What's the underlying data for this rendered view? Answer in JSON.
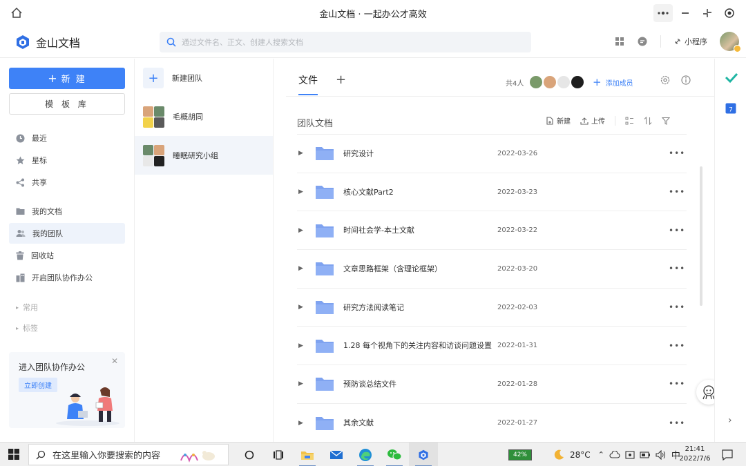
{
  "window": {
    "title": "金山文档 · 一起办公才高效",
    "controls": [
      "more-icon",
      "minimize-icon",
      "restore-icon",
      "record-icon"
    ]
  },
  "app": {
    "name": "金山文档",
    "search_placeholder": "通过文件名、正文、创建人搜索文档",
    "mini_program": "小程序",
    "accent": "#3e82f7"
  },
  "sidebar": {
    "new_label": "新 建",
    "template_label": "模 板 库",
    "items": [
      {
        "label": "最近",
        "icon": "clock-icon"
      },
      {
        "label": "星标",
        "icon": "star-icon"
      },
      {
        "label": "共享",
        "icon": "share-icon"
      },
      {
        "label": "我的文档",
        "icon": "folder-icon"
      },
      {
        "label": "我的团队",
        "icon": "team-icon"
      },
      {
        "label": "回收站",
        "icon": "trash-icon"
      },
      {
        "label": "开启团队协作办公",
        "icon": "office-icon"
      }
    ],
    "sub_items": [
      "常用",
      "标签"
    ],
    "promo": {
      "title": "进入团队协作办公",
      "button": "立即创建"
    }
  },
  "teams": {
    "new_team": "新建团队",
    "items": [
      "毛概胡同",
      "睡眠研究小组"
    ]
  },
  "main": {
    "tab": "文件",
    "member_count": "共4人",
    "add_member": "添加成员",
    "section_title": "团队文档",
    "actions": {
      "new": "新建",
      "upload": "上传"
    },
    "files": [
      {
        "name": "研究设计",
        "date": "2022-03-26"
      },
      {
        "name": "核心文献Part2",
        "date": "2022-03-23"
      },
      {
        "name": "时间社会学-本土文献",
        "date": "2022-03-22"
      },
      {
        "name": "文章思路框架（含理论框架）",
        "date": "2022-03-20"
      },
      {
        "name": "研究方法阅读笔记",
        "date": "2022-02-03"
      },
      {
        "name": "1.28 每个视角下的关注内容和访谈问题设置",
        "date": "2022-01-31"
      },
      {
        "name": "预防谈总结文件",
        "date": "2022-01-28"
      },
      {
        "name": "其余文献",
        "date": "2022-01-27"
      }
    ],
    "more": "•••"
  },
  "taskbar": {
    "search_text": "在这里输入你要搜索的内容",
    "battery": "42%",
    "temperature": "28°C",
    "ime": "中",
    "time": "21:41",
    "date": "2022/7/6"
  }
}
